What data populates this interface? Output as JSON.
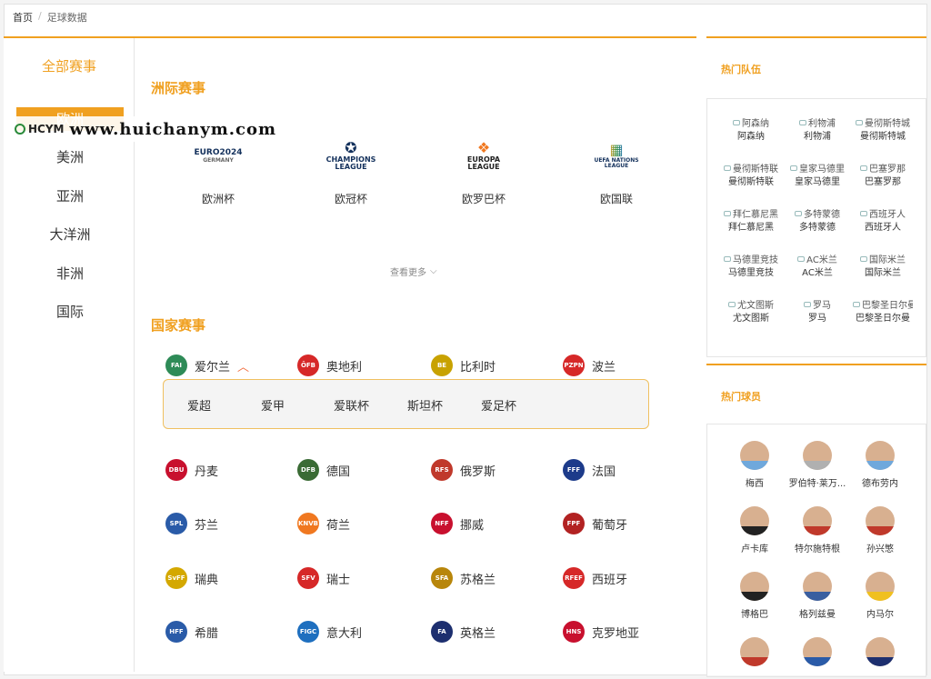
{
  "breadcrumb": {
    "home": "首页",
    "current": "足球数据"
  },
  "watermark": {
    "logo": "HCYM",
    "text": "www.huichanym.com"
  },
  "left_nav": {
    "title": "全部赛事",
    "items": [
      "欧洲",
      "美洲",
      "亚洲",
      "大洋洲",
      "非洲",
      "国际"
    ],
    "active_index": 0
  },
  "intercontinental": {
    "title": "洲际赛事",
    "cups": [
      {
        "name": "欧洲杯",
        "logo_text": "EURO2024",
        "logo_sub": "GERMANY"
      },
      {
        "name": "欧冠杯",
        "logo_text": "CHAMPIONS",
        "logo_sub": "LEAGUE"
      },
      {
        "name": "欧罗巴杯",
        "logo_text": "EUROPA",
        "logo_sub": "LEAGUE"
      },
      {
        "name": "欧国联",
        "logo_text": "UEFA NATIONS",
        "logo_sub": "LEAGUE"
      }
    ],
    "more_label": "查看更多"
  },
  "national": {
    "title": "国家赛事",
    "countries": [
      {
        "name": "爱尔兰",
        "badge": "FAI",
        "color": "#2e8b57"
      },
      {
        "name": "奥地利",
        "badge": "ÖFB",
        "color": "#d62828"
      },
      {
        "name": "比利时",
        "badge": "BE",
        "color": "#c8a200"
      },
      {
        "name": "波兰",
        "badge": "PZPN",
        "color": "#d62828"
      },
      {
        "name": "丹麦",
        "badge": "DBU",
        "color": "#c8102e"
      },
      {
        "name": "德国",
        "badge": "DFB",
        "color": "#3a6b35"
      },
      {
        "name": "俄罗斯",
        "badge": "RFS",
        "color": "#c0392b"
      },
      {
        "name": "法国",
        "badge": "FFF",
        "color": "#1d3b8a"
      },
      {
        "name": "芬兰",
        "badge": "SPL",
        "color": "#2a5ba8"
      },
      {
        "name": "荷兰",
        "badge": "KNVB",
        "color": "#f07820"
      },
      {
        "name": "挪威",
        "badge": "NFF",
        "color": "#c8102e"
      },
      {
        "name": "葡萄牙",
        "badge": "FPF",
        "color": "#b22222"
      },
      {
        "name": "瑞典",
        "badge": "SvFF",
        "color": "#d4a800"
      },
      {
        "name": "瑞士",
        "badge": "SFV",
        "color": "#d62828"
      },
      {
        "name": "苏格兰",
        "badge": "SFA",
        "color": "#b8860b"
      },
      {
        "name": "西班牙",
        "badge": "RFEF",
        "color": "#d62828"
      },
      {
        "name": "希腊",
        "badge": "HFF",
        "color": "#2a5ba8"
      },
      {
        "name": "意大利",
        "badge": "FIGC",
        "color": "#1e6fbf"
      },
      {
        "name": "英格兰",
        "badge": "FA",
        "color": "#1d2f6f"
      },
      {
        "name": "克罗地亚",
        "badge": "HNS",
        "color": "#c8102e"
      }
    ],
    "expanded_index": 0,
    "sub_leagues": [
      "爱超",
      "爱甲",
      "爱联杯",
      "斯坦杯",
      "爱足杯"
    ]
  },
  "hot_teams": {
    "title": "热门队伍",
    "teams": [
      {
        "logo_alt": "阿森纳",
        "name": "阿森纳"
      },
      {
        "logo_alt": "利物浦",
        "name": "利物浦"
      },
      {
        "logo_alt": "曼彻斯特城",
        "name": "曼彻斯特城"
      },
      {
        "logo_alt": "曼彻斯特联",
        "name": "曼彻斯特联"
      },
      {
        "logo_alt": "皇家马德里",
        "name": "皇家马德里"
      },
      {
        "logo_alt": "巴塞罗那",
        "name": "巴塞罗那"
      },
      {
        "logo_alt": "拜仁慕尼黑",
        "name": "拜仁慕尼黑"
      },
      {
        "logo_alt": "多特蒙德",
        "name": "多特蒙德"
      },
      {
        "logo_alt": "西班牙人",
        "name": "西班牙人"
      },
      {
        "logo_alt": "马德里竞技",
        "name": "马德里竞技"
      },
      {
        "logo_alt": "AC米兰",
        "name": "AC米兰"
      },
      {
        "logo_alt": "国际米兰",
        "name": "国际米兰"
      },
      {
        "logo_alt": "尤文图斯",
        "name": "尤文图斯"
      },
      {
        "logo_alt": "罗马",
        "name": "罗马"
      },
      {
        "logo_alt": "巴黎圣日尔曼",
        "name": "巴黎圣日尔曼"
      }
    ]
  },
  "hot_players": {
    "title": "热门球员",
    "players": [
      {
        "name": "梅西",
        "shirt": "#6fa8dc"
      },
      {
        "name": "罗伯特·莱万...",
        "shirt": "#b0b0b0"
      },
      {
        "name": "德布劳内",
        "shirt": "#6fa8dc"
      },
      {
        "name": "卢卡库",
        "shirt": "#222222"
      },
      {
        "name": "特尔施特根",
        "shirt": "#c0392b"
      },
      {
        "name": "孙兴慜",
        "shirt": "#c0392b"
      },
      {
        "name": "博格巴",
        "shirt": "#222222"
      },
      {
        "name": "格列兹曼",
        "shirt": "#3a5fa0"
      },
      {
        "name": "内马尔",
        "shirt": "#f0c020"
      },
      {
        "name": "",
        "shirt": "#c0392b"
      },
      {
        "name": "",
        "shirt": "#2a5ba8"
      },
      {
        "name": "",
        "shirt": "#1d2f6f"
      }
    ]
  }
}
